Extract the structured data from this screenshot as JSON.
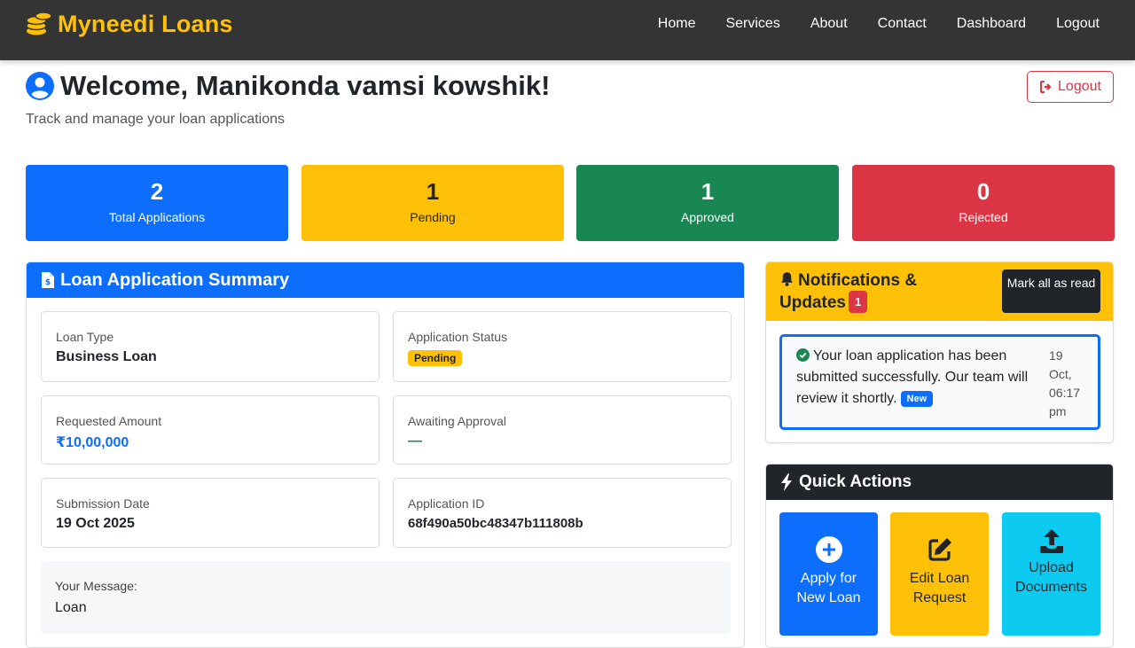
{
  "navbar": {
    "brand": "Myneedi Loans",
    "brand_icon": "coins-icon",
    "links": [
      "Home",
      "Services",
      "About",
      "Contact",
      "Dashboard",
      "Logout"
    ]
  },
  "welcome": {
    "title": "Welcome, Manikonda vamsi kowshik!",
    "subtitle": "Track and manage your loan applications",
    "logout_label": "Logout"
  },
  "stats": [
    {
      "value": "2",
      "label": "Total Applications",
      "color": "#0d6efd"
    },
    {
      "value": "1",
      "label": "Pending",
      "color": "#ffc107"
    },
    {
      "value": "1",
      "label": "Approved",
      "color": "#198754"
    },
    {
      "value": "0",
      "label": "Rejected",
      "color": "#dc3545"
    }
  ],
  "summary": {
    "title": "Loan Application Summary",
    "loan_type_label": "Loan Type",
    "loan_type": "Business Loan",
    "status_label": "Application Status",
    "status": "Pending",
    "amount_label": "Requested Amount",
    "amount": "₹10,00,000",
    "awaiting_label": "Awaiting Approval",
    "awaiting": "—",
    "date_label": "Submission Date",
    "date": "19 Oct 2025",
    "id_label": "Application ID",
    "id": "68f490a50bc48347b111808b",
    "message_label": "Your Message:",
    "message": "Loan"
  },
  "notifications": {
    "title": "Notifications & Updates",
    "count": "1",
    "mark_all_label": "Mark all as read",
    "items": [
      {
        "text": "Your loan application has been submitted successfully. Our team will review it shortly.",
        "badge": "New",
        "time": "19 Oct, 06:17 pm"
      }
    ]
  },
  "quick_actions": {
    "title": "Quick Actions",
    "items": [
      {
        "label": "Apply for New Loan",
        "icon": "plus-circle-icon",
        "color": "#0d6efd"
      },
      {
        "label": "Edit Loan Request",
        "icon": "edit-icon",
        "color": "#ffc107"
      },
      {
        "label": "Upload Documents",
        "icon": "upload-icon",
        "color": "#0dcaf0"
      }
    ]
  }
}
